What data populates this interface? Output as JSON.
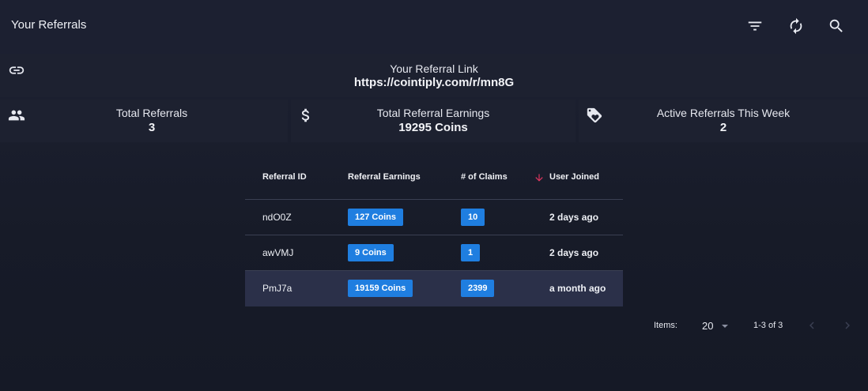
{
  "header": {
    "title": "Your Referrals",
    "icons": [
      "filter-icon",
      "refresh-icon",
      "search-icon"
    ]
  },
  "referral_link": {
    "label": "Your Referral Link",
    "url": "https://cointiply.com/r/mn8G"
  },
  "stats": [
    {
      "icon": "people-icon",
      "label": "Total Referrals",
      "value": "3"
    },
    {
      "icon": "dollar-icon",
      "label": "Total Referral Earnings",
      "value": "19295 Coins"
    },
    {
      "icon": "tag-icon",
      "label": "Active Referrals This Week",
      "value": "2"
    }
  ],
  "table": {
    "columns": [
      "Referral ID",
      "Referral Earnings",
      "# of Claims",
      "User Joined"
    ],
    "rows": [
      {
        "id": "ndO0Z",
        "earnings": "127 Coins",
        "claims": "10",
        "joined": "2 days ago"
      },
      {
        "id": "awVMJ",
        "earnings": "9 Coins",
        "claims": "1",
        "joined": "2 days ago"
      },
      {
        "id": "PmJ7a",
        "earnings": "19159 Coins",
        "claims": "2399",
        "joined": "a month ago"
      }
    ]
  },
  "pagination": {
    "items_label": "Items:",
    "items_per_page": "20",
    "range": "1-3 of 3"
  },
  "colors": {
    "chip": "#1f7ee0",
    "sort_arrow": "#e0365f",
    "highlight_row": "#2b3049"
  }
}
